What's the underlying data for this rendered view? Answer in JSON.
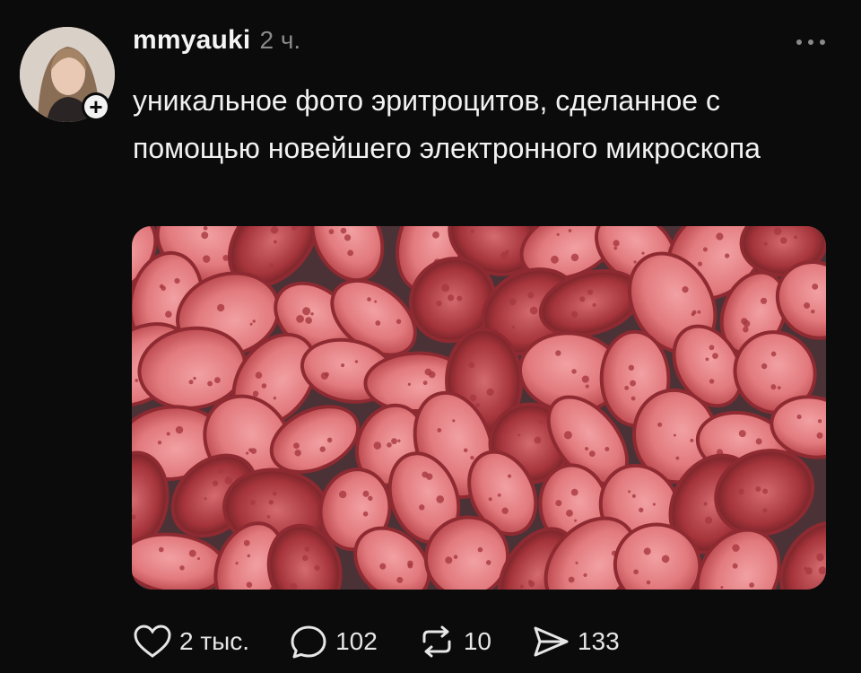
{
  "post": {
    "username": "mmyauki",
    "time": "2 ч.",
    "text": "уникальное фото эритроцитов, сделанное с помощью новейшего электронного микроскопа"
  },
  "actions": {
    "likes": "2 тыс.",
    "comments": "102",
    "reposts": "10",
    "shares": "133"
  },
  "icons": {
    "like": "heart-icon",
    "comment": "comment-bubble-icon",
    "repost": "repost-arrows-icon",
    "share": "send-icon",
    "more": "more-dots-icon",
    "follow": "plus-icon"
  },
  "colors": {
    "background": "#0b0b0b",
    "text": "#f2f2f2",
    "muted": "#8a8a8a"
  }
}
